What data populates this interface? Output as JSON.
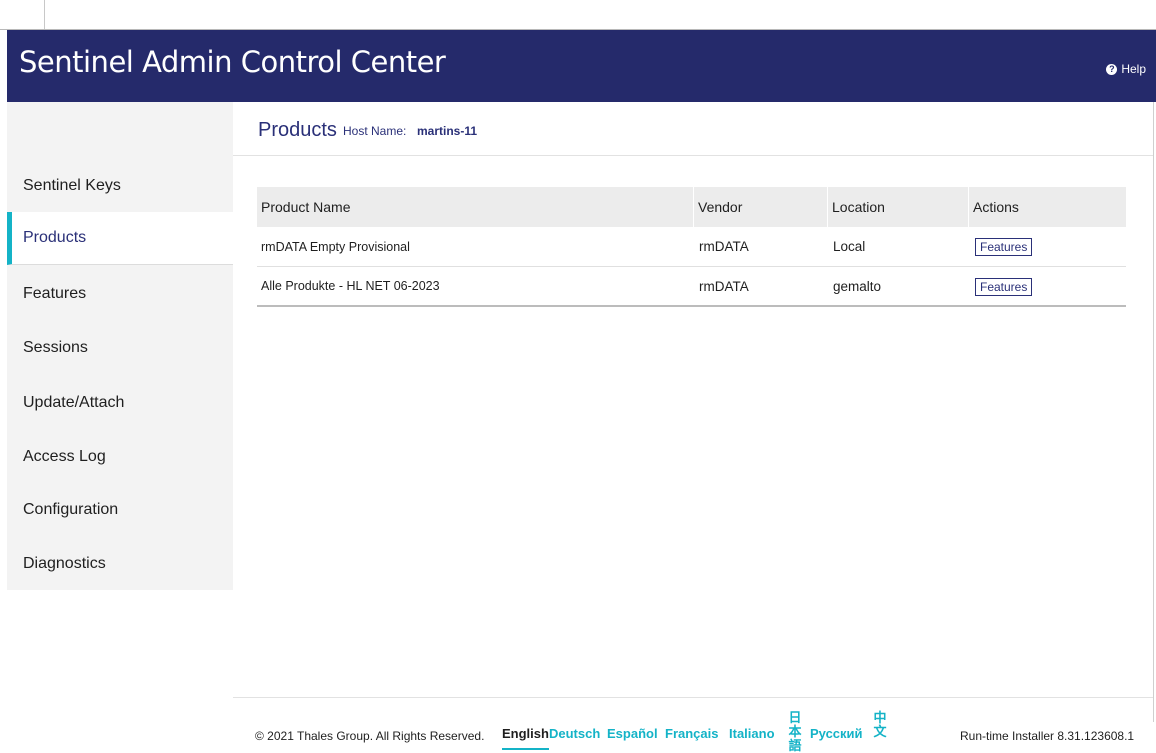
{
  "header": {
    "brand_light": "Sentinel",
    "brand_strong": "Admin Control Center",
    "help_label": "Help"
  },
  "sidebar": {
    "items": [
      {
        "label": "Sentinel Keys",
        "active": false
      },
      {
        "label": "Products",
        "active": true
      },
      {
        "label": "Features",
        "active": false
      },
      {
        "label": "Sessions",
        "active": false
      },
      {
        "label": "Update/Attach",
        "active": false
      },
      {
        "label": "Access Log",
        "active": false
      },
      {
        "label": "Configuration",
        "active": false
      },
      {
        "label": "Diagnostics",
        "active": false
      }
    ]
  },
  "main": {
    "title": "Products",
    "host_label": "Host Name:",
    "host_value": "martins-11",
    "table": {
      "headers": [
        "Product Name",
        "Vendor",
        "Location",
        "Actions"
      ],
      "rows": [
        {
          "product": "rmDATA Empty Provisional",
          "vendor": "rmDATA",
          "location": "Local",
          "action": "Features"
        },
        {
          "product": "Alle Produkte - HL NET 06-2023",
          "vendor": "rmDATA",
          "location": "gemalto",
          "action": "Features"
        }
      ]
    }
  },
  "footer": {
    "copyright": "© 2021 Thales Group. All Rights Reserved.",
    "languages": [
      "English",
      "Deutsch",
      "Español",
      "Français",
      "Italiano",
      "日本語",
      "Русский",
      "中文"
    ],
    "current_language": "English",
    "version": "Run-time Installer 8.31.123608.1"
  },
  "colors": {
    "header_bg": "#252a6b",
    "accent": "#14b3c7",
    "sidebar_bg": "#f3f3f3",
    "text_primary": "#2a3078"
  },
  "icons": {
    "help": "question-circle-icon"
  }
}
